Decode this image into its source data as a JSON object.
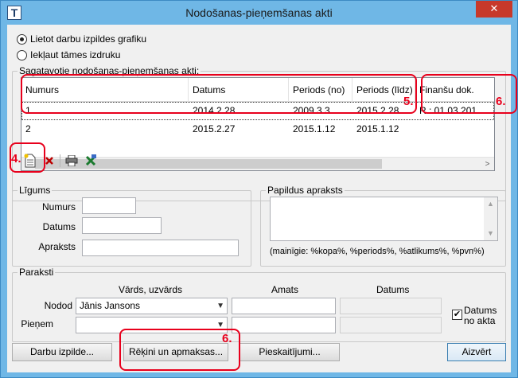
{
  "window": {
    "title": "Nodošanas-pieņemšanas akti",
    "close_glyph": "✕",
    "app_icon_glyph": "T"
  },
  "radios": {
    "option1": "Lietot darbu izpildes grafiku",
    "option2": "Iekļaut tāmes izdruku",
    "selected": "option1"
  },
  "acts": {
    "group_title": "Sagatavotie nodošanas-pieņemšanas akti:",
    "columns": [
      "Numurs",
      "Datums",
      "Periods (no)",
      "Periods (līdz)",
      "Finanšu dok."
    ],
    "rows": [
      [
        "1",
        "2014.2.28",
        "2009.3.3",
        "2015.2.28",
        "R.: 01.03.201..."
      ],
      [
        "2",
        "2015.2.27",
        "2015.1.12",
        "2015.1.12",
        ""
      ]
    ],
    "scroll_left": "<",
    "scroll_right": ">"
  },
  "toolbar": {
    "icons": [
      "new-document-icon",
      "delete-icon",
      "print-icon",
      "excel-export-icon"
    ]
  },
  "ligums": {
    "group_title": "Līgums",
    "numurs_label": "Numurs",
    "datums_label": "Datums",
    "apraksts_label": "Apraksts",
    "numurs_value": "",
    "datums_value": "",
    "apraksts_value": ""
  },
  "papildus": {
    "group_title": "Papildus apraksts",
    "value": "",
    "hint": "(mainīgie: %kopa%, %periods%, %atlikums%, %pvn%)"
  },
  "paraksti": {
    "group_title": "Paraksti",
    "col_name": "Vārds, uzvārds",
    "col_amats": "Amats",
    "col_datums": "Datums",
    "nodod_label": "Nodod",
    "pienem_label": "Pieņem",
    "nodod_name": "Jānis Jansons",
    "pienem_name": "",
    "datums_no_akta_label": "Datums no akta",
    "datums_no_akta_checked": true
  },
  "buttons": {
    "darbu_izpilde": "Darbu izpilde...",
    "rekini": "Rēķini un apmaksas...",
    "pieskaitijumi": "Pieskaitījumi...",
    "aizvert": "Aizvērt"
  },
  "annotations": {
    "a4": "4.",
    "a5": "5.",
    "a6_top": "6.",
    "a6_bottom": "6."
  },
  "colors": {
    "title_bar": "#6fb7e6",
    "close": "#c7392b",
    "annotation": "#e8001c"
  }
}
